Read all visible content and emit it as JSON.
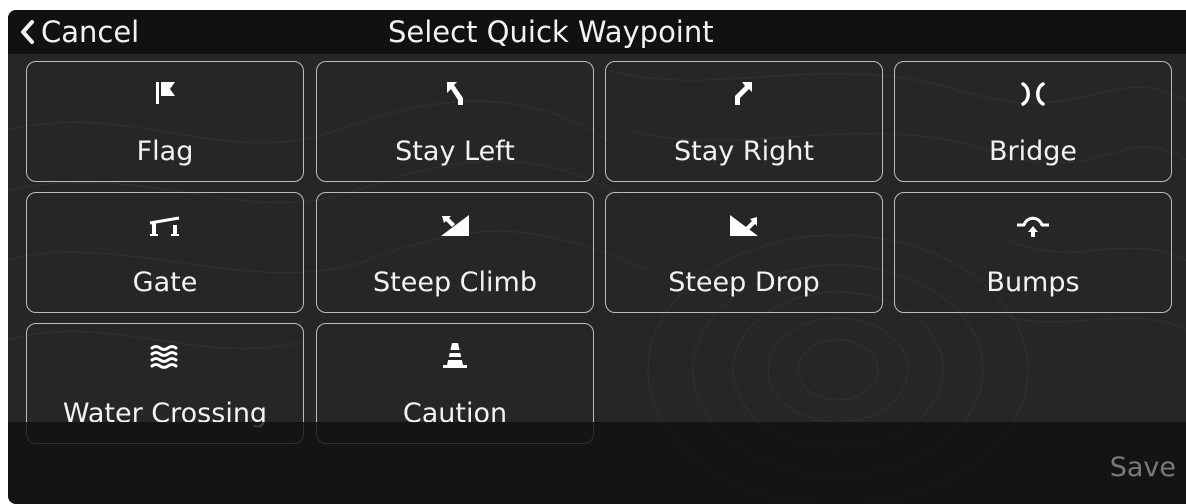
{
  "header": {
    "cancel_label": "Cancel",
    "title": "Select Quick Waypoint"
  },
  "waypoints": [
    {
      "label": "Flag",
      "icon": "flag-icon"
    },
    {
      "label": "Stay Left",
      "icon": "stay-left-icon"
    },
    {
      "label": "Stay Right",
      "icon": "stay-right-icon"
    },
    {
      "label": "Bridge",
      "icon": "bridge-icon"
    },
    {
      "label": "Gate",
      "icon": "gate-icon"
    },
    {
      "label": "Steep Climb",
      "icon": "steep-climb-icon"
    },
    {
      "label": "Steep Drop",
      "icon": "steep-drop-icon"
    },
    {
      "label": "Bumps",
      "icon": "bumps-icon"
    },
    {
      "label": "Water Crossing",
      "icon": "water-crossing-icon"
    },
    {
      "label": "Caution",
      "icon": "caution-icon"
    }
  ],
  "footer": {
    "save_label": "Save"
  },
  "colors": {
    "background": "#262626",
    "header": "#111111",
    "text": "#f2f2f2",
    "border": "#bdbdbd",
    "save_disabled": "#7a7a7a"
  }
}
